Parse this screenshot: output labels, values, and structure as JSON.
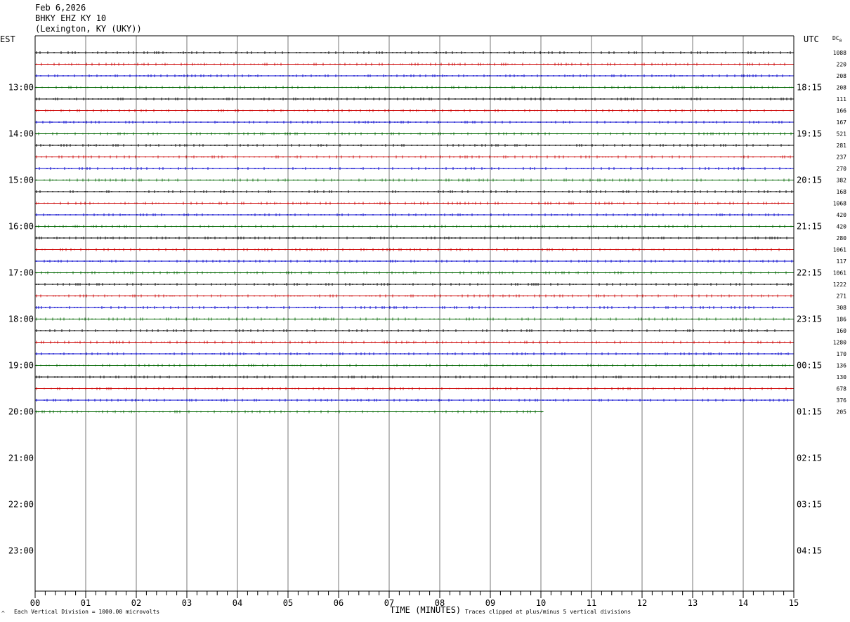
{
  "header": {
    "date": "Feb 6,2026",
    "station": "BHKY EHZ KY 10",
    "location": "(Lexington, KY (UKY))"
  },
  "left_axis_label": "EST",
  "right_axis_label": "UTC",
  "dc_label": "DC",
  "dc_subscript": "0",
  "footer": {
    "corner_mark": "^",
    "left_note": "Each Vertical Division = 1000.00 microvolts",
    "xlabel": "TIME (MINUTES)",
    "right_note": "Traces clipped at plus/minus 5 vertical divisions"
  },
  "chart_data": {
    "type": "line",
    "title": "BHKY EHZ KY 10",
    "xlabel": "TIME (MINUTES)",
    "x_ticks": [
      "00",
      "01",
      "02",
      "03",
      "04",
      "05",
      "06",
      "07",
      "08",
      "09",
      "10",
      "11",
      "12",
      "13",
      "14",
      "15"
    ],
    "xlim": [
      0,
      15
    ],
    "row_minutes": 15,
    "left_time_labels": [
      "13:00",
      "14:00",
      "15:00",
      "16:00",
      "17:00",
      "18:00",
      "19:00",
      "20:00",
      "21:00",
      "22:00",
      "23:00"
    ],
    "right_time_labels": [
      "18:15",
      "19:15",
      "20:15",
      "21:15",
      "22:15",
      "23:15",
      "00:15",
      "01:15",
      "02:15",
      "03:15",
      "04:15"
    ],
    "trace_colors": [
      "#000000",
      "#cc0000",
      "#0000cc",
      "#006600"
    ],
    "dc_offsets": [
      "1088",
      "220",
      "208",
      "208",
      "111",
      "166",
      "167",
      "521",
      "281",
      "237",
      "270",
      "382",
      "168",
      "1068",
      "420",
      "420",
      "280",
      "1061",
      "117",
      "1061",
      "1222",
      "271",
      "308",
      "186",
      "160",
      "1280",
      "170",
      "136",
      "130",
      "678",
      "376",
      "205"
    ],
    "last_trace_end_minute": 10.05,
    "grid": true
  }
}
